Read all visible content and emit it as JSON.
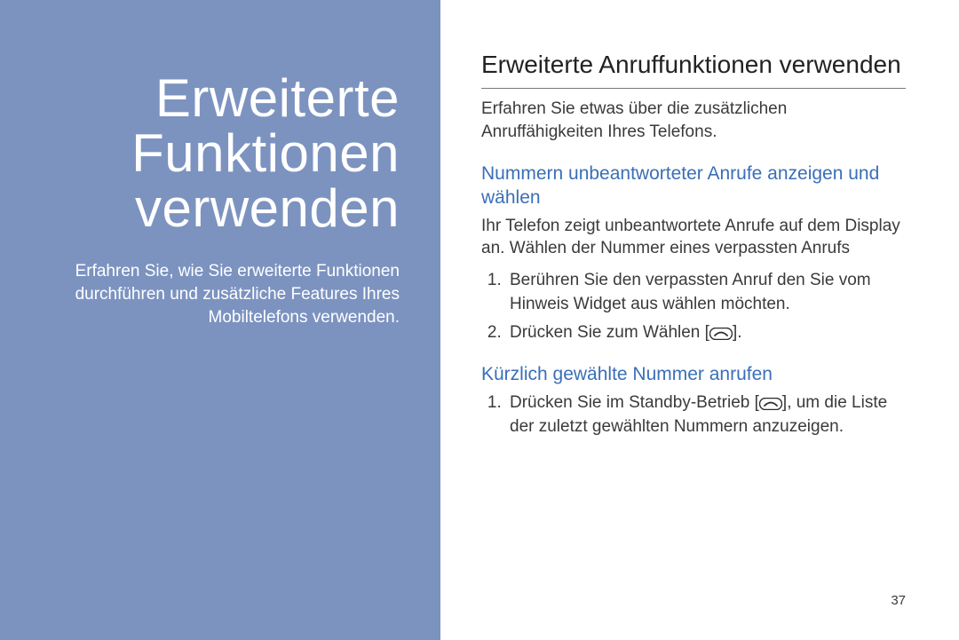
{
  "left": {
    "title_line1": "Erweiterte",
    "title_line2": "Funktionen",
    "title_line3": "verwenden",
    "desc": "Erfahren Sie, wie Sie erweiterte Funktionen durchführen und zusätzliche Features Ihres Mobiltelefons verwenden."
  },
  "right": {
    "heading": "Erweiterte Anruffunktionen verwenden",
    "intro": "Erfahren Sie etwas über die zusätzlichen Anruffähigkeiten Ihres Telefons.",
    "section1": {
      "heading": "Nummern unbeantworteter Anrufe anzeigen und wählen",
      "body": "Ihr Telefon zeigt unbeantwortete Anrufe auf dem Display an. Wählen der Nummer eines verpassten Anrufs",
      "steps": [
        "Berühren Sie den verpassten Anruf den Sie vom Hinweis Widget aus wählen möchten.",
        "Drücken Sie zum Wählen"
      ],
      "step2_suffix": "."
    },
    "section2": {
      "heading": "Kürzlich gewählte Nummer anrufen",
      "step1_prefix": "Drücken Sie im Standby-Betrieb",
      "step1_suffix": ", um die Liste der zuletzt gewählten Nummern anzuzeigen."
    }
  },
  "icons": {
    "call_key": "call-button-icon"
  },
  "page_number": "37"
}
